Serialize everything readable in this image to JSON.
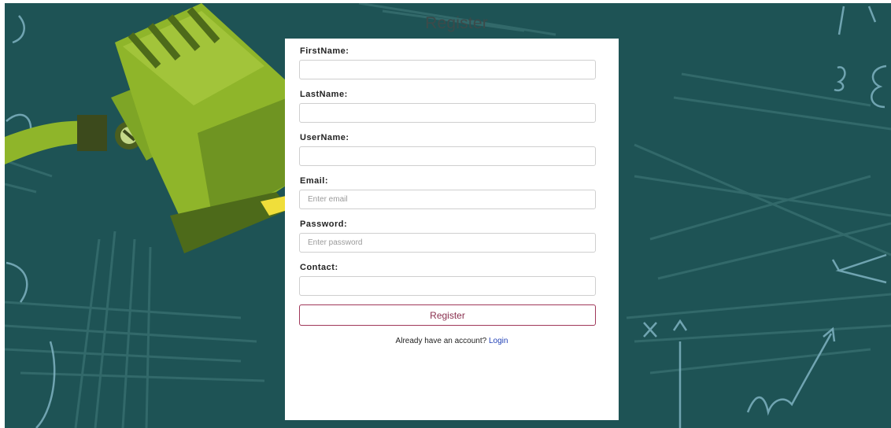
{
  "header": {
    "title": "Register"
  },
  "form": {
    "fields": [
      {
        "label": "FirstName:",
        "value": "",
        "placeholder": ""
      },
      {
        "label": "LastName:",
        "value": "",
        "placeholder": ""
      },
      {
        "label": "UserName:",
        "value": "",
        "placeholder": ""
      },
      {
        "label": "Email:",
        "value": "",
        "placeholder": "Enter email"
      },
      {
        "label": "Password:",
        "value": "",
        "placeholder": "Enter password"
      },
      {
        "label": "Contact:",
        "value": "",
        "placeholder": ""
      }
    ],
    "submit_label": "Register",
    "account_prompt": "Already have an account?",
    "login_link": "Login"
  },
  "colors": {
    "board": "#1e5355",
    "lamp_green": "#8fb52a",
    "button_border": "#a0385a",
    "link": "#1f3fb5"
  },
  "icons": [
    "desk-lamp-illustration",
    "chalk-doodles"
  ]
}
